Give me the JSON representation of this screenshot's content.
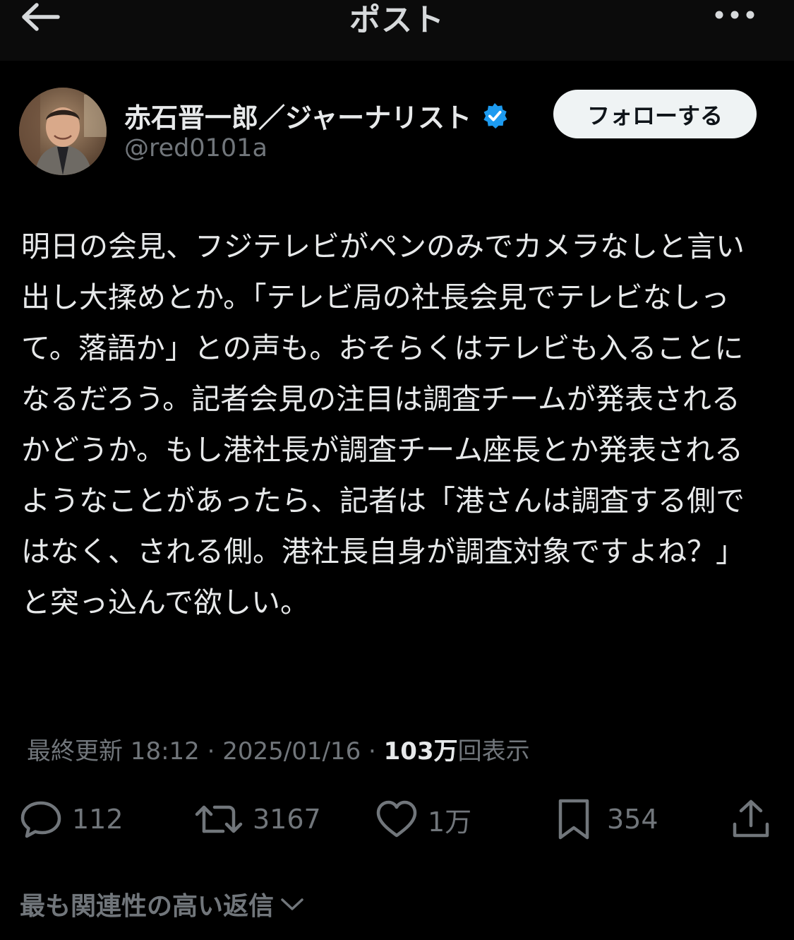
{
  "header": {
    "title": "ポスト",
    "back_icon": "arrow-left-icon",
    "more_icon": "more-horizontal-icon"
  },
  "author": {
    "name": "赤石晋一郎／ジャーナリスト",
    "handle": "@red0101a",
    "verified_color": "#1d9bf0",
    "follow_label": "フォローする"
  },
  "post": {
    "text": "明日の会見、フジテレビがペンのみでカメラなしと言い出し大揉めとか。「テレビ局の社長会見でテレビなしって。落語か」との声も。おそらくはテレビも入ることになるだろう。記者会見の注目は調査チームが発表されるかどうか。もし港社長が調査チーム座長とか発表されるようなことがあったら、記者は「港さんは調査する側ではなく、される側。港社長自身が調査対象ですよね？」と突っ込んで欲しい。"
  },
  "meta": {
    "updated_label": "最終更新 18:12",
    "separator": " · ",
    "date": "2025/01/16",
    "separator2": " · ",
    "views_count": "103万",
    "views_label": "回表示"
  },
  "actions": {
    "reply": {
      "icon": "reply-icon",
      "count": "112"
    },
    "repost": {
      "icon": "repost-icon",
      "count": "3167"
    },
    "like": {
      "icon": "heart-icon",
      "count": "1万"
    },
    "bookmark": {
      "icon": "bookmark-icon",
      "count": "354"
    },
    "share": {
      "icon": "share-icon"
    }
  },
  "replies": {
    "sort_label": "最も関連性の高い返信",
    "sort_icon": "chevron-down-icon"
  },
  "colors": {
    "background": "#000000",
    "text_primary": "#e7e9ea",
    "text_secondary": "#71767b",
    "follow_button_bg": "#eff3f4"
  }
}
